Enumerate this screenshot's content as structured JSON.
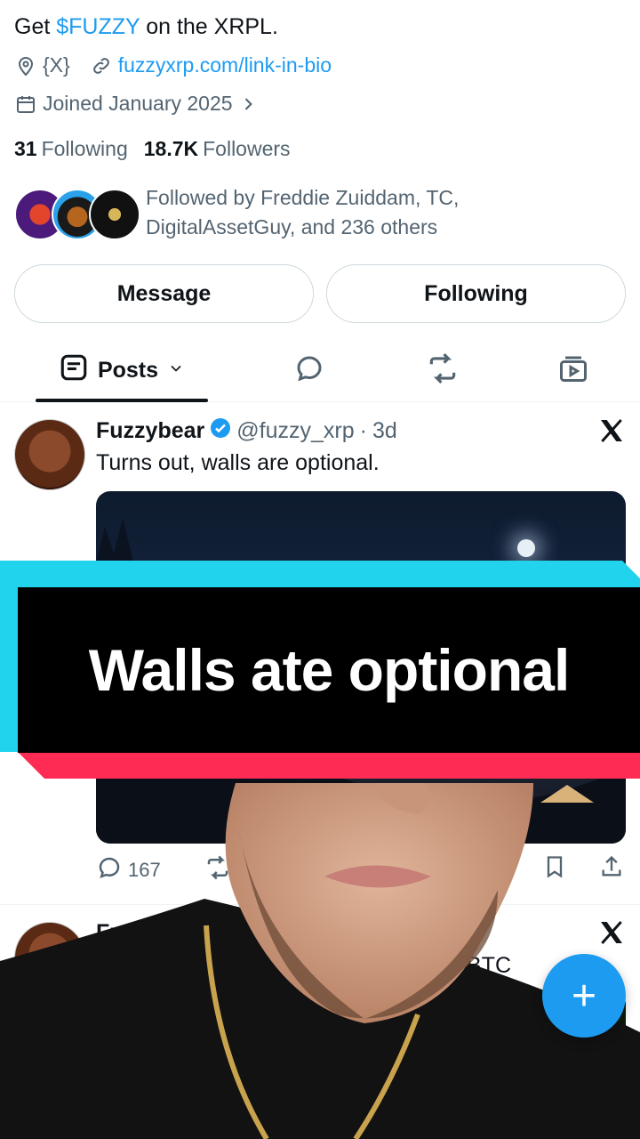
{
  "profile": {
    "bio_prefix": "Get ",
    "bio_cashtag": "$FUZZY",
    "bio_suffix": " on the XRPL.",
    "location": "{X}",
    "website": "fuzzyxrp.com/link-in-bio",
    "joined": "Joined January 2025",
    "following_count": "31",
    "following_label": "Following",
    "followers_count": "18.7K",
    "followers_label": "Followers",
    "followed_by": "Followed by Freddie Zuiddam, TC, DigitalAssetGuy, and 236 others"
  },
  "buttons": {
    "message": "Message",
    "following": "Following"
  },
  "tabs": {
    "posts": "Posts"
  },
  "post1": {
    "name": "Fuzzybear",
    "handle": "@fuzzy_xrp",
    "sep": "·",
    "time": "3d",
    "text": "Turns out, walls are optional.",
    "replies": "167"
  },
  "post2": {
    "name_partial": "Fuzzyb",
    "text_partial": "BTC"
  },
  "caption": {
    "text": "Walls ate optional"
  },
  "colors": {
    "accent": "#1d9bf0",
    "caption_cyan": "#22d3ee",
    "caption_red": "#fe2c55"
  }
}
